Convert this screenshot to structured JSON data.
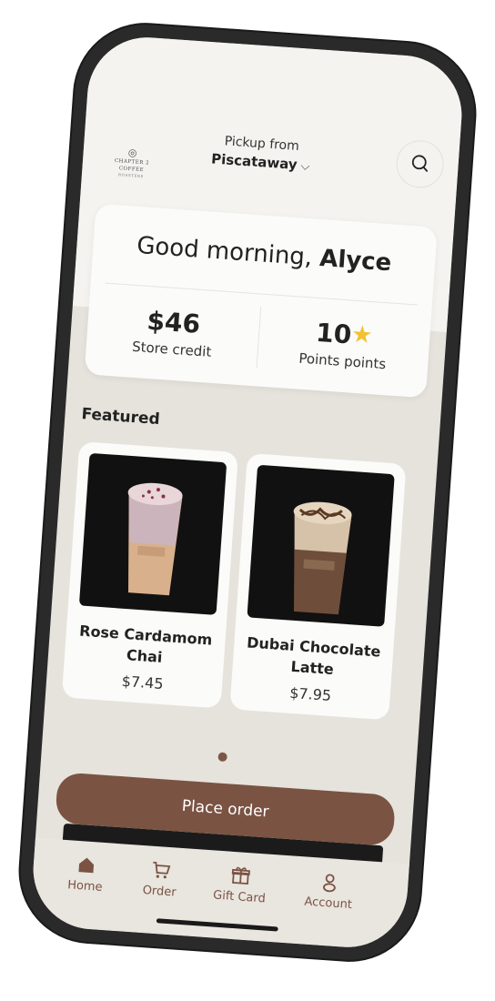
{
  "brand": {
    "logo_name": "CHAPTER 2 COFFEE",
    "logo_sub": "ROASTERS"
  },
  "header": {
    "pickup_label": "Pickup from",
    "pickup_location": "Piscataway"
  },
  "greeting": {
    "prefix": "Good morning, ",
    "name": "Alyce"
  },
  "stats": {
    "store_credit_value": "$46",
    "store_credit_label": "Store credit",
    "points_value": "10",
    "points_label": "Points points"
  },
  "featured": {
    "title": "Featured",
    "items": [
      {
        "name": "Rose Cardamom Chai",
        "price": "$7.45"
      },
      {
        "name": "Dubai Chocolate Latte",
        "price": "$7.95"
      }
    ]
  },
  "actions": {
    "place_order": "Place order"
  },
  "tabbar": {
    "items": [
      {
        "label": "Home",
        "icon": "home-icon"
      },
      {
        "label": "Order",
        "icon": "cart-icon"
      },
      {
        "label": "Gift Card",
        "icon": "gift-icon"
      },
      {
        "label": "Account",
        "icon": "person-icon"
      }
    ]
  },
  "colors": {
    "accent": "#7a5343",
    "background": "#e6e3dc",
    "star": "#f2c230"
  }
}
